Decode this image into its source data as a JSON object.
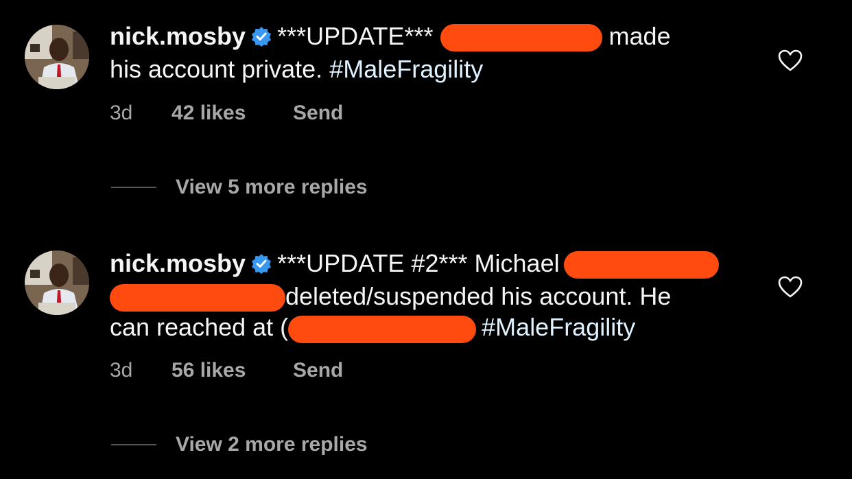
{
  "comments": [
    {
      "username": "nick.mosby",
      "text_parts": {
        "prefix": "***UPDATE***",
        "after_redact": "made",
        "line2": "his account private.",
        "hashtag": "#MaleFragility"
      },
      "age": "3d",
      "likes": "42 likes",
      "send": "Send",
      "replies_label": "View 5 more replies"
    },
    {
      "username": "nick.mosby",
      "text_parts": {
        "prefix": "***UPDATE #2*** Michael",
        "line2_after_redact": "deleted/suspended his account. He",
        "line3_prefix": "can reached at (",
        "hashtag": "#MaleFragility"
      },
      "age": "3d",
      "likes": "56 likes",
      "send": "Send",
      "replies_label": "View 2 more replies"
    }
  ],
  "icons": {
    "verified": "verified-badge-icon",
    "like": "heart-outline-icon"
  },
  "colors": {
    "background": "#000000",
    "verified": "#3897f0",
    "redaction": "#ff4a10",
    "meta_text": "#a8a8a8"
  }
}
